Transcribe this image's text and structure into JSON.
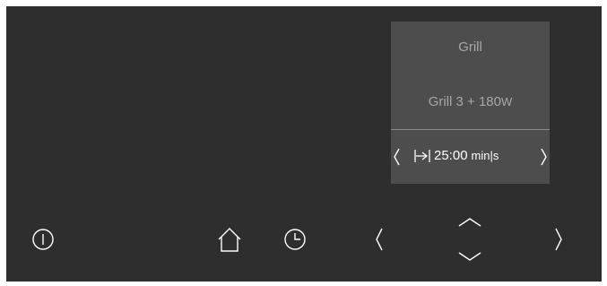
{
  "display": {
    "title": "Grill",
    "mode_label": "Grill 3 + 180",
    "mode_unit": "W",
    "timer_value": "25:00",
    "timer_unit": "min|s",
    "timer_icon": "timer-end-icon",
    "prev_icon": "chevron-left-icon",
    "next_icon": "chevron-right-icon"
  },
  "controls": {
    "power_icon": "power-icon",
    "home_icon": "home-icon",
    "clock_icon": "clock-icon",
    "left_icon": "chevron-left-icon",
    "up_icon": "chevron-up-icon",
    "down_icon": "chevron-down-icon",
    "right_icon": "chevron-right-icon"
  },
  "colors": {
    "panel": "#2e2e2e",
    "card": "#4d4d4d",
    "text_dim": "#a7a7a7",
    "text_bright": "#ffffff"
  }
}
